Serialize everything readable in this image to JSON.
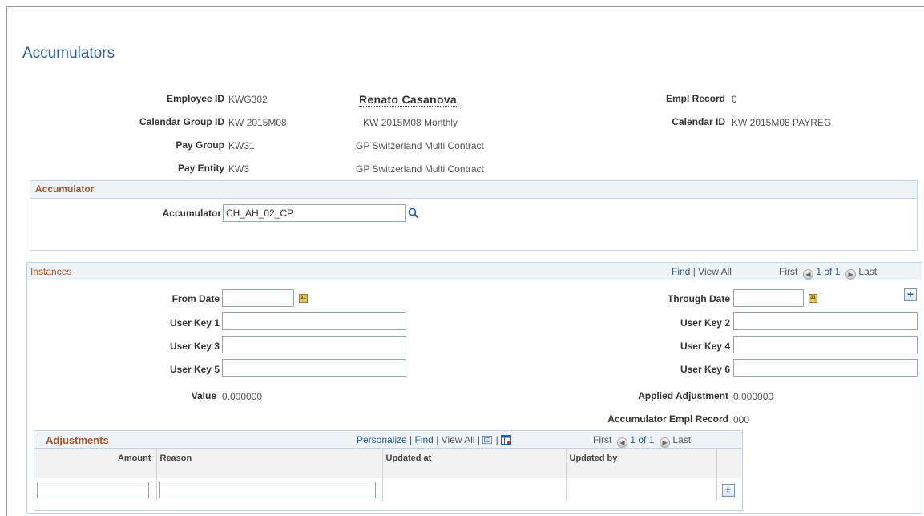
{
  "page": {
    "title": "Accumulators"
  },
  "header": {
    "employee_id_label": "Employee ID",
    "employee_id": "KWG302",
    "employee_name": "Renato Casanova",
    "empl_record_label": "Empl Record",
    "empl_record": "0",
    "calendar_group_id_label": "Calendar Group ID",
    "calendar_group_id": "KW 2015M08",
    "calendar_group_desc": "KW 2015M08 Monthly",
    "calendar_id_label": "Calendar ID",
    "calendar_id": "KW 2015M08 PAYREG",
    "pay_group_label": "Pay Group",
    "pay_group": "KW31",
    "pay_group_desc": "GP Switzerland Multi Contract",
    "pay_entity_label": "Pay Entity",
    "pay_entity": "KW3",
    "pay_entity_desc": "GP Switzerland Multi Contract"
  },
  "accumulator_section": {
    "title": "Accumulator",
    "accumulator_label": "Accumulator",
    "accumulator_value": "CH_AH_02_CP",
    "search_icon": "search-icon"
  },
  "instances": {
    "title": "Instances",
    "find": "Find",
    "sep": "|",
    "view_all": "View All",
    "first": "First",
    "page": "1 of 1",
    "last": "Last",
    "from_date_label": "From Date",
    "from_date": "",
    "through_date_label": "Through Date",
    "through_date": "",
    "user_key_1_label": "User Key 1",
    "user_key_1": "",
    "user_key_2_label": "User Key 2",
    "user_key_2": "",
    "user_key_3_label": "User Key 3",
    "user_key_3": "",
    "user_key_4_label": "User Key 4",
    "user_key_4": "",
    "user_key_5_label": "User Key 5",
    "user_key_5": "",
    "user_key_6_label": "User Key 6",
    "user_key_6": "",
    "value_label": "Value",
    "value": "0.000000",
    "applied_adjustment_label": "Applied Adjustment",
    "applied_adjustment": "0.000000",
    "acc_empl_record_label": "Accumulator Empl Record",
    "acc_empl_record": "000",
    "calendar_icon_text": "31",
    "add_symbol": "+"
  },
  "adjustments": {
    "title": "Adjustments",
    "personalize": "Personalize",
    "find": "Find",
    "view_all": "View All",
    "first": "First",
    "page": "1 of 1",
    "last": "Last",
    "columns": [
      "Amount",
      "Reason",
      "Updated at",
      "Updated by"
    ],
    "row": {
      "amount": "",
      "reason": ""
    },
    "add_symbol": "+"
  },
  "colors": {
    "title_blue": "#2b5d9a",
    "section_orange": "#a5552a",
    "header_bg": "#eef3f8"
  }
}
